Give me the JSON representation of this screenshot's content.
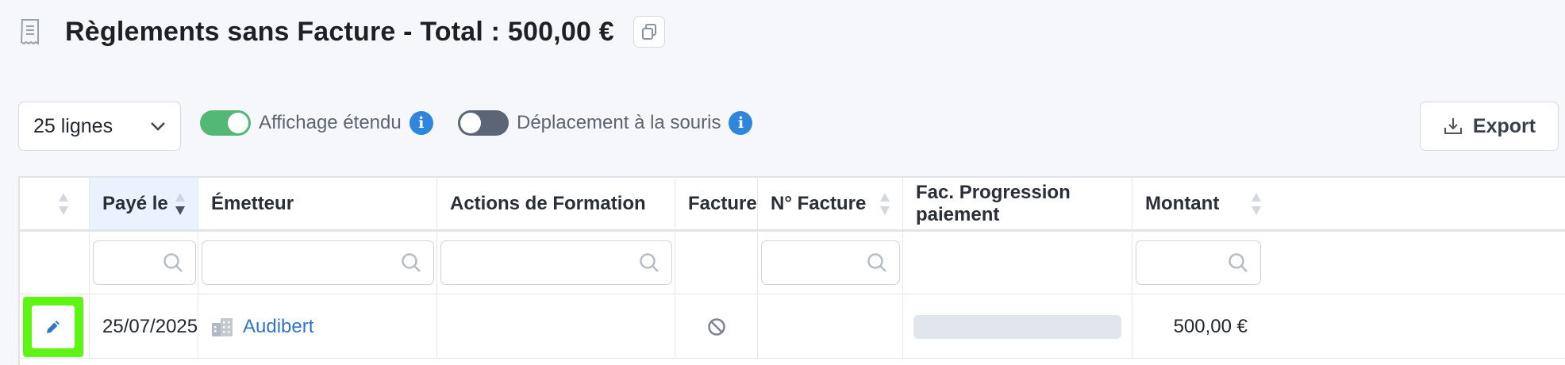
{
  "header": {
    "title": "Règlements sans Facture - Total : 500,00 €",
    "title_icon": "document-icon",
    "copy_icon": "copy-icon"
  },
  "toolbar": {
    "lines_select": {
      "value": "25 lignes",
      "icon": "chevron-down-icon"
    },
    "toggles": [
      {
        "label": "Affichage étendu",
        "state": "on",
        "color": "#52b873"
      },
      {
        "label": "Déplacement à la souris",
        "state": "off",
        "color": "#5b6576"
      }
    ],
    "export_label": "Export",
    "export_icon": "download-icon"
  },
  "table": {
    "columns": [
      {
        "key": "actions",
        "label": "",
        "sortable": true
      },
      {
        "key": "paye_le",
        "label": "Payé le",
        "sortable": true,
        "sorted": "desc"
      },
      {
        "key": "emetteur",
        "label": "Émetteur"
      },
      {
        "key": "actions_formation",
        "label": "Actions de Formation"
      },
      {
        "key": "facture",
        "label": "Facture"
      },
      {
        "key": "num_facture",
        "label": "N° Facture",
        "sortable": true
      },
      {
        "key": "progression",
        "label": "Fac. Progression paiement"
      },
      {
        "key": "montant",
        "label": "Montant",
        "sortable": true
      }
    ],
    "filters": {
      "paye_le": "",
      "emetteur": "",
      "actions_formation": "",
      "num_facture": "",
      "montant": ""
    },
    "rows": [
      {
        "paye_le": "25/07/2025",
        "emetteur": "Audibert",
        "emetteur_icon": "building-icon",
        "actions_formation": "",
        "facture_icon": "no-invoice-icon",
        "num_facture": "",
        "progression": 0,
        "montant": "500,00 €"
      }
    ]
  },
  "colors": {
    "accent": "#2f86dd",
    "link": "#2f76c9",
    "edit_highlight": "#5ef514",
    "sorted_header": "#eaf3fd"
  }
}
